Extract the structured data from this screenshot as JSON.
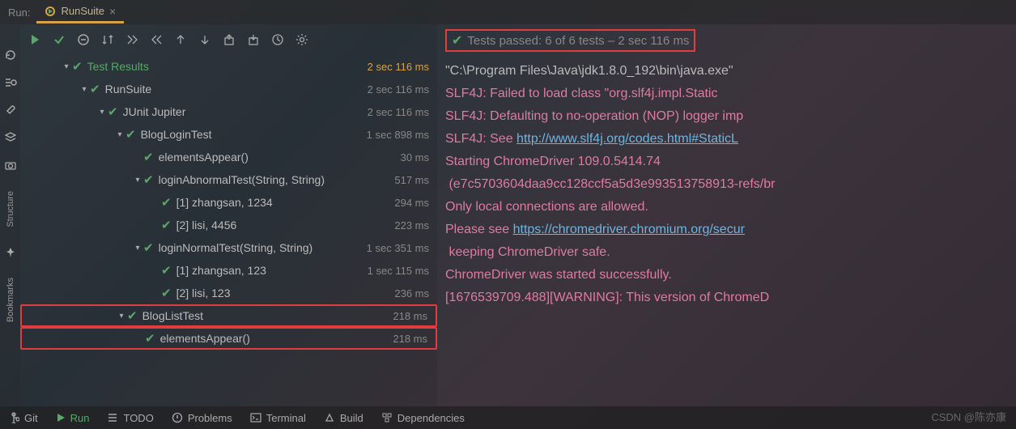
{
  "header": {
    "run_label": "Run:",
    "tab_title": "RunSuite"
  },
  "status": {
    "text": "Tests passed: 6 of 6 tests – 2 sec 116 ms"
  },
  "tree": [
    {
      "depth": 0,
      "arrow": true,
      "name": "Test Results",
      "time": "2 sec 116 ms",
      "bold": true
    },
    {
      "depth": 1,
      "arrow": true,
      "name": "RunSuite",
      "time": "2 sec 116 ms"
    },
    {
      "depth": 2,
      "arrow": true,
      "name": "JUnit Jupiter",
      "time": "2 sec 116 ms"
    },
    {
      "depth": 3,
      "arrow": true,
      "name": "BlogLoginTest",
      "time": "1 sec 898 ms"
    },
    {
      "depth": 4,
      "arrow": false,
      "name": "elementsAppear()",
      "time": "30 ms"
    },
    {
      "depth": 4,
      "arrow": true,
      "name": "loginAbnormalTest(String, String)",
      "time": "517 ms"
    },
    {
      "depth": 5,
      "arrow": false,
      "name": "[1] zhangsan, 1234",
      "time": "294 ms"
    },
    {
      "depth": 5,
      "arrow": false,
      "name": "[2] lisi, 4456",
      "time": "223 ms"
    },
    {
      "depth": 4,
      "arrow": true,
      "name": "loginNormalTest(String, String)",
      "time": "1 sec 351 ms"
    },
    {
      "depth": 5,
      "arrow": false,
      "name": "[1] zhangsan, 123",
      "time": "1 sec 115 ms"
    },
    {
      "depth": 5,
      "arrow": false,
      "name": "[2] lisi, 123",
      "time": "236 ms"
    },
    {
      "depth": 3,
      "arrow": true,
      "name": "BlogListTest",
      "time": "218 ms",
      "hl": true
    },
    {
      "depth": 4,
      "arrow": false,
      "name": "elementsAppear()",
      "time": "218 ms",
      "hl": true
    }
  ],
  "console": [
    {
      "cls": "gray",
      "text": "\"C:\\Program Files\\Java\\jdk1.8.0_192\\bin\\java.exe\" "
    },
    {
      "cls": "pink",
      "text": "SLF4J: Failed to load class \"org.slf4j.impl.Static"
    },
    {
      "cls": "pink",
      "text": "SLF4J: Defaulting to no-operation (NOP) logger imp"
    },
    {
      "cls": "pink",
      "prefix": "SLF4J: See ",
      "link": "http://www.slf4j.org/codes.html#StaticL"
    },
    {
      "cls": "pink",
      "text": "Starting ChromeDriver 109.0.5414.74"
    },
    {
      "cls": "pink",
      "text": " (e7c5703604daa9cc128ccf5a5d3e993513758913-refs/br"
    },
    {
      "cls": "pink",
      "text": "Only local connections are allowed."
    },
    {
      "cls": "pink",
      "prefix": "Please see ",
      "link": "https://chromedriver.chromium.org/secur"
    },
    {
      "cls": "pink",
      "text": " keeping ChromeDriver safe."
    },
    {
      "cls": "pink",
      "text": "ChromeDriver was started successfully."
    },
    {
      "cls": "pink",
      "text": "[1676539709.488][WARNING]: This version of ChromeD"
    }
  ],
  "bottombar": {
    "git": "Git",
    "run": "Run",
    "todo": "TODO",
    "problems": "Problems",
    "terminal": "Terminal",
    "build": "Build",
    "deps": "Dependencies"
  },
  "side": {
    "structure": "Structure",
    "bookmarks": "Bookmarks"
  },
  "credit": "CSDN @陈亦康"
}
